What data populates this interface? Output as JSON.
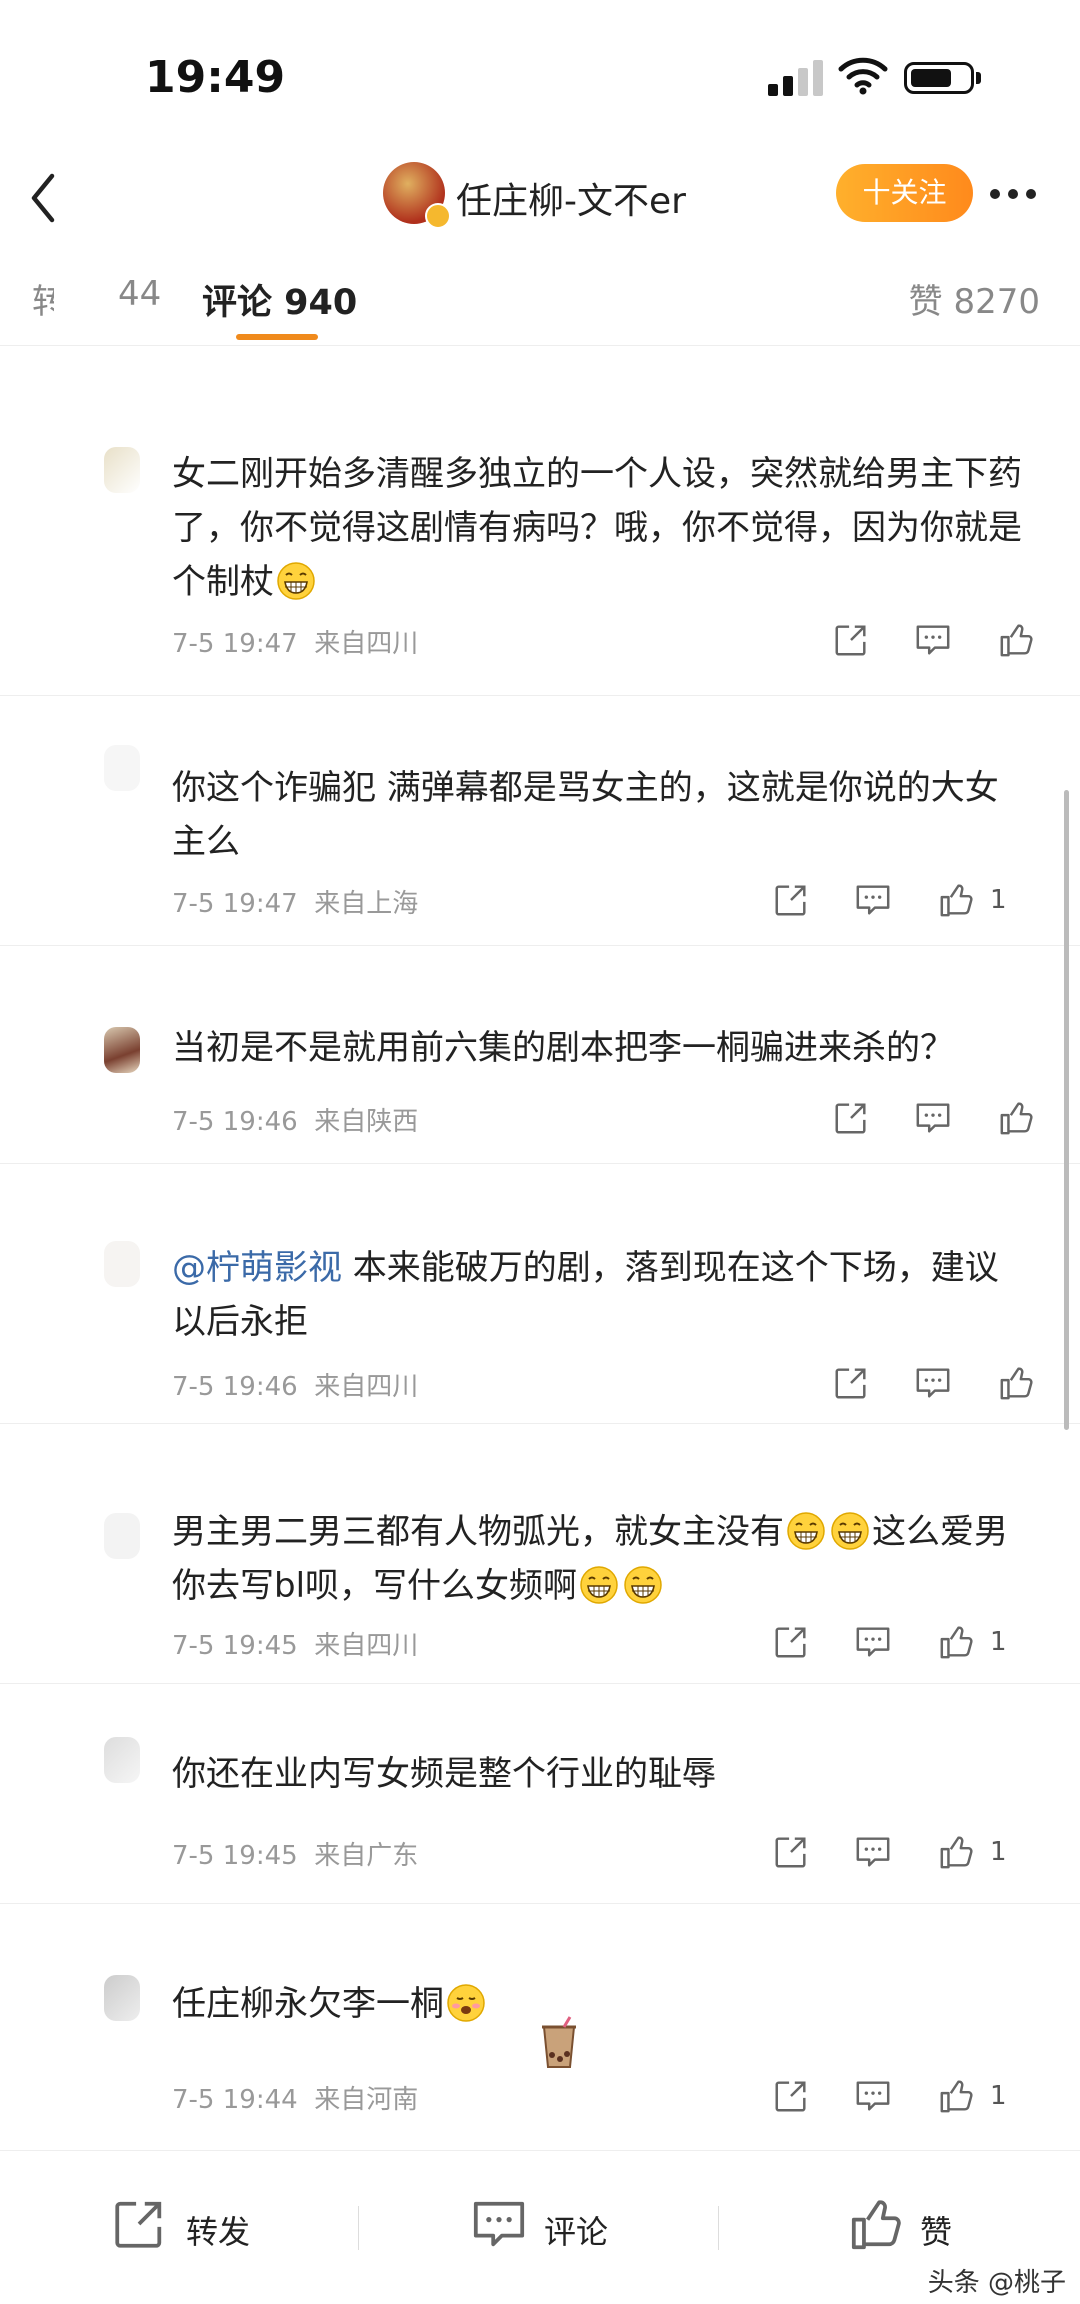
{
  "status_bar": {
    "time": "19:49"
  },
  "nav": {
    "title": "任庄柳-文不er",
    "follow_label": "十关注"
  },
  "tabs": {
    "partial": "转",
    "repost_count": "44",
    "comments_label": "评论 940",
    "likes_label": "赞 8270"
  },
  "comments": [
    {
      "text": "女二刚开始多清醒多独立的一个人设，突然就给男主下药了，你不觉得这剧情有病吗？哦，你不觉得，因为你就是个制杖",
      "time": "7-5 19:47",
      "location": "来自四川",
      "likes": ""
    },
    {
      "text": "你这个诈骗犯 满弹幕都是骂女主的，这就是你说的大女主么",
      "time": "7-5 19:47",
      "location": "来自上海",
      "likes": "1"
    },
    {
      "text": "当初是不是就用前六集的剧本把李一桐骗进来杀的？",
      "time": "7-5 19:46",
      "location": "来自陕西",
      "likes": ""
    },
    {
      "mention": "@柠萌影视",
      "text": " 本来能破万的剧，落到现在这个下场，建议以后永拒",
      "time": "7-5 19:46",
      "location": "来自四川",
      "likes": ""
    },
    {
      "text_a": "男主男二男三都有人物弧光，就女主没有",
      "text_b": "这么爱男你去写bl呗，写什么女频啊",
      "time": "7-5 19:45",
      "location": "来自四川",
      "likes": "1"
    },
    {
      "text": "你还在业内写女频是整个行业的耻辱",
      "time": "7-5 19:45",
      "location": "来自广东",
      "likes": "1"
    },
    {
      "text": "任庄柳永欠李一桐",
      "time": "7-5 19:44",
      "location": "来自河南",
      "likes": "1"
    }
  ],
  "bottom_bar": {
    "repost": "转发",
    "comment": "评论",
    "like": "赞"
  },
  "watermark": "头条 @桃子",
  "colors": {
    "accent": "#f08a1c",
    "mention": "#3b6aa8",
    "meta": "#999999"
  }
}
